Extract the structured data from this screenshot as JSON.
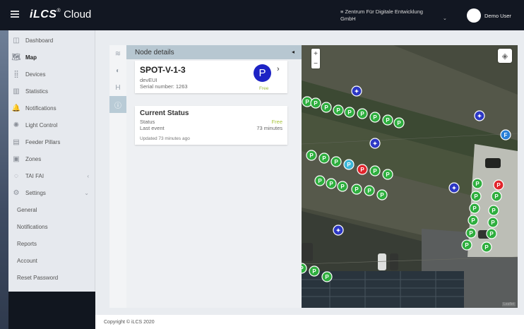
{
  "topbar": {
    "logo_brand": "iLCS",
    "logo_mark": "®",
    "logo_product": "Cloud",
    "org": "≡ Zentrum Für Digitale Entwicklung GmbH",
    "org_caret": "⌄",
    "user": "Demo User"
  },
  "sidebar": {
    "items": [
      {
        "label": "Dashboard",
        "icon": "dashboard-icon",
        "glyph": "◫"
      },
      {
        "label": "Map",
        "icon": "map-icon",
        "glyph": "🗺"
      },
      {
        "label": "Devices",
        "icon": "devices-icon",
        "glyph": "⣿"
      },
      {
        "label": "Statistics",
        "icon": "statistics-icon",
        "glyph": "▥"
      },
      {
        "label": "Notifications",
        "icon": "bell-icon",
        "glyph": "🔔"
      },
      {
        "label": "Light Control",
        "icon": "light-icon",
        "glyph": "✺"
      },
      {
        "label": "Feeder Pillars",
        "icon": "feeder-icon",
        "glyph": "▤"
      },
      {
        "label": "Zones",
        "icon": "zones-icon",
        "glyph": "▣"
      },
      {
        "label": "TAI FAI",
        "icon": "tai-fai-icon",
        "glyph": "◌",
        "chevron": "‹"
      },
      {
        "label": "Settings",
        "icon": "settings-icon",
        "glyph": "⚙",
        "chevron": "⌄"
      }
    ],
    "sub_items": [
      "General",
      "Notifications",
      "Reports",
      "Account",
      "Reset Password"
    ]
  },
  "panel": {
    "title": "Node details",
    "collapse_glyph": "◂",
    "tabs": [
      {
        "icon": "layers-tab-icon",
        "glyph": "≋"
      },
      {
        "icon": "palette-tab-icon",
        "glyph": "◐"
      },
      {
        "icon": "h-tab-icon",
        "glyph": "H"
      },
      {
        "icon": "info-tab-icon",
        "glyph": "ⓘ"
      }
    ],
    "node": {
      "name": "SPOT-V-1-3",
      "deveui_label": "devEUI",
      "serial": "Serial number: 1263",
      "badge": "P",
      "state": "Free",
      "chevron": "›"
    },
    "status": {
      "title": "Current Status",
      "rows": [
        {
          "label": "Status",
          "value": "Free"
        },
        {
          "label": "Last event",
          "value": "73 minutes"
        }
      ],
      "updated": "Updated 73 minutes ago"
    }
  },
  "map": {
    "zoom_in": "+",
    "zoom_out": "−",
    "layers_glyph": "◈",
    "attribution": "Leaflet",
    "markers": [
      {
        "kind": "free",
        "glyph": "P"
      },
      {
        "kind": "occupied",
        "glyph": "P"
      },
      {
        "kind": "selected",
        "glyph": "P"
      },
      {
        "kind": "lamp",
        "glyph": "✦"
      },
      {
        "kind": "feeder",
        "glyph": "F"
      }
    ]
  },
  "footer": {
    "copyright": "Copyright © iLCS 2020"
  },
  "colors": {
    "topbar": "#121722",
    "free_marker": "#2eae3e",
    "occupied_marker": "#e0242b",
    "selected_marker": "#3bb7d8",
    "lamp_marker": "#2c37c4",
    "accent_free": "#9cbc3a"
  }
}
